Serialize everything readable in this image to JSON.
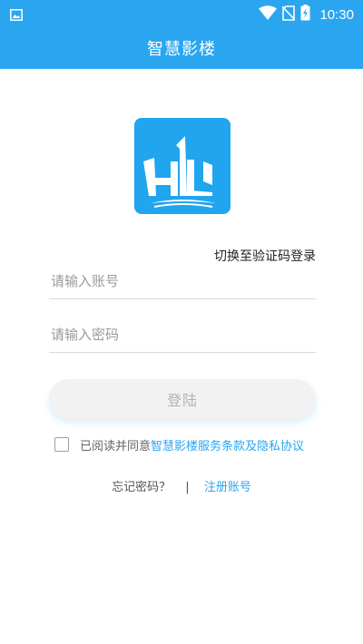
{
  "statusbar": {
    "time": "10:30"
  },
  "appbar": {
    "title": "智慧影楼"
  },
  "login": {
    "switch_link": "切换至验证码登录",
    "account_placeholder": "请输入账号",
    "password_placeholder": "请输入密码",
    "login_button": "登陆",
    "agree_prefix": "已阅读并同意",
    "agree_link": "智慧影楼服务条款及隐私协议",
    "forgot_password": "忘记密码？",
    "separator": "|",
    "register": "注册账号"
  },
  "colors": {
    "primary": "#2aa6f0",
    "logo_bg": "#20a5ee"
  },
  "icons": [
    "image-icon",
    "wifi-icon",
    "no-sim-icon",
    "battery-charging-icon"
  ]
}
